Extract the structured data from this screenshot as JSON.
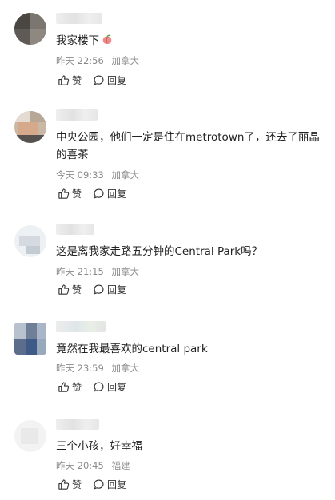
{
  "comments": [
    {
      "text": "我家楼下",
      "emoji": "peach-emoji",
      "time": "昨天 22:56",
      "location": "加拿大",
      "like_label": "赞",
      "reply_label": "回复"
    },
    {
      "text": "中央公园，他们一定是住在metrotown了，还去了丽晶的喜茶",
      "time": "今天 09:33",
      "location": "加拿大",
      "like_label": "赞",
      "reply_label": "回复"
    },
    {
      "text": "这是离我家走路五分钟的Central Park吗？",
      "time": "昨天 21:15",
      "location": "加拿大",
      "like_label": "赞",
      "reply_label": "回复"
    },
    {
      "text": "竟然在我最喜欢的central park",
      "time": "昨天 23:59",
      "location": "加拿大",
      "like_label": "赞",
      "reply_label": "回复"
    },
    {
      "text": "三个小孩，好幸福",
      "time": "昨天 20:45",
      "location": "福建",
      "like_label": "赞",
      "reply_label": "回复"
    }
  ],
  "icons": {
    "like": "thumbs-up-icon",
    "reply": "speech-bubble-icon"
  },
  "colors": {
    "text": "#222222",
    "meta": "#8a8a8a",
    "background": "#ffffff"
  }
}
